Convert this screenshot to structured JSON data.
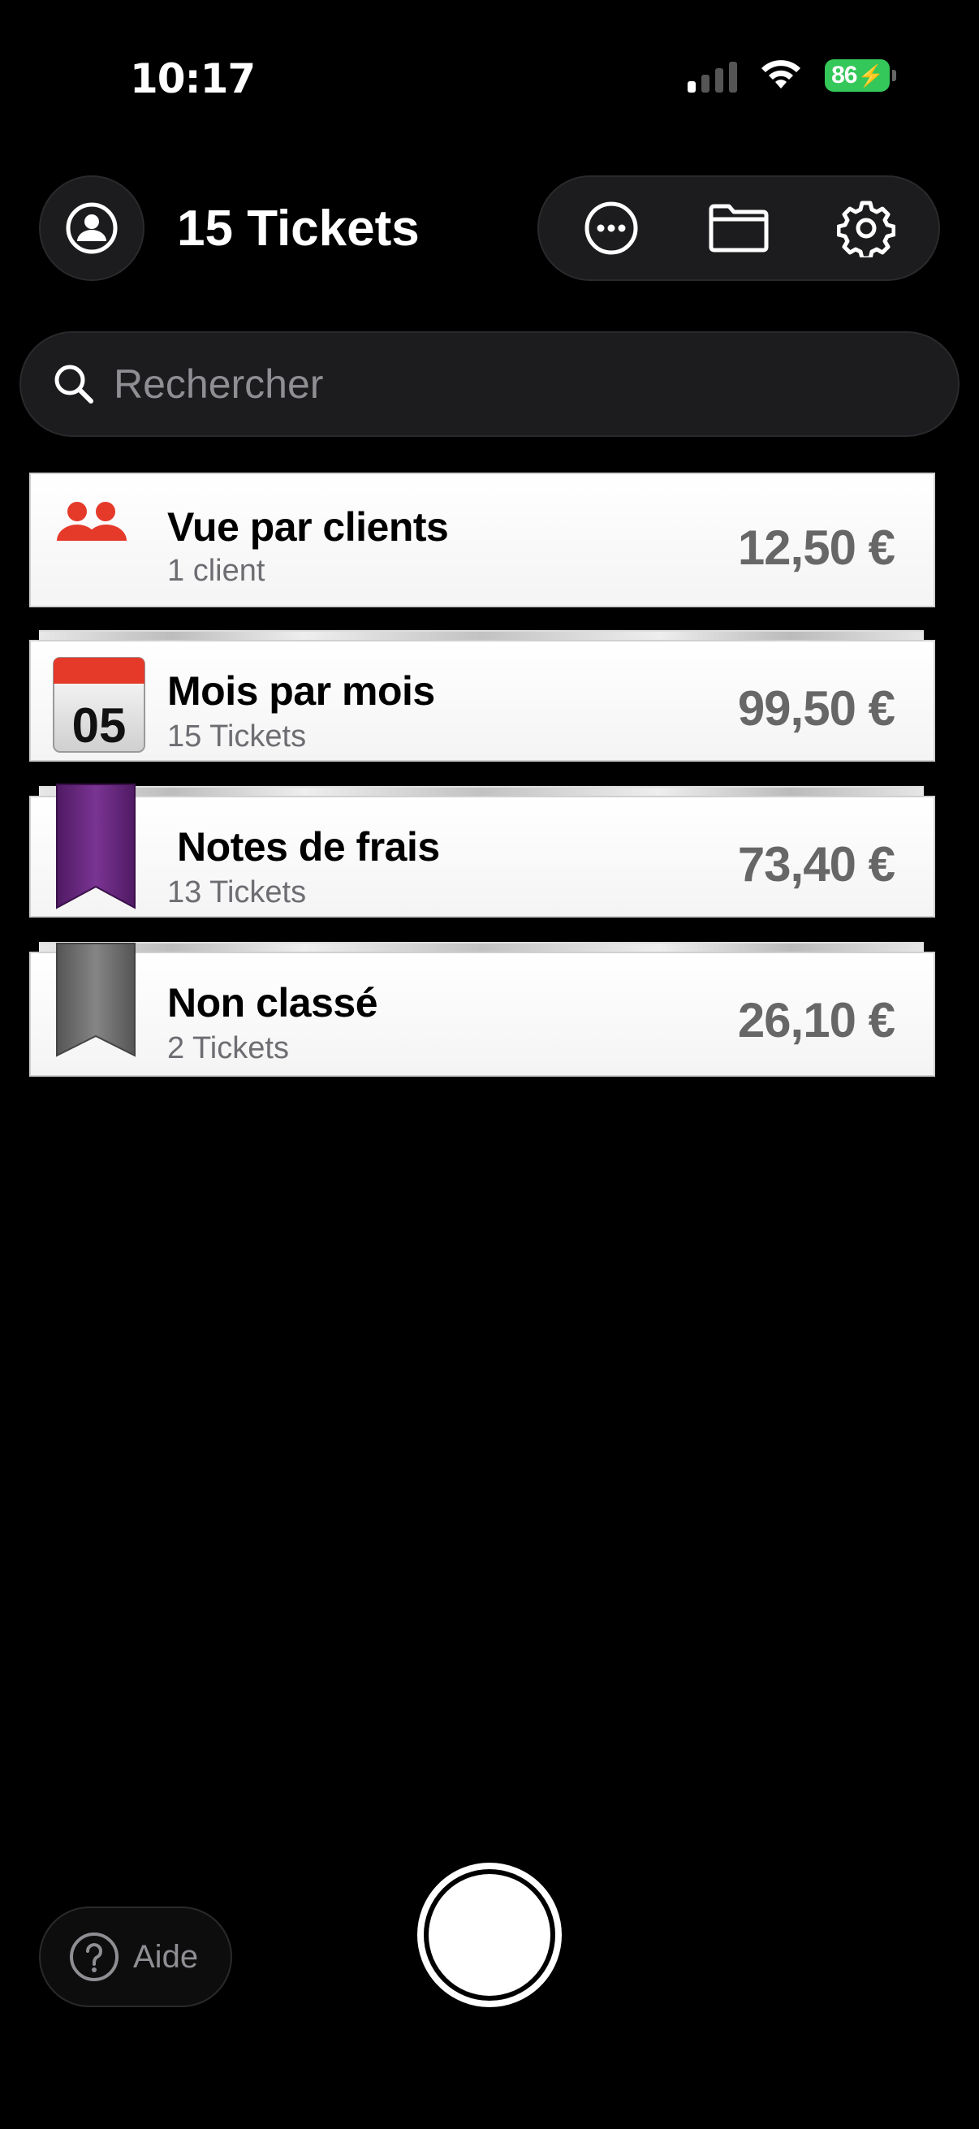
{
  "status_bar": {
    "time": "10:17",
    "battery": "86"
  },
  "header": {
    "title": "15 Tickets"
  },
  "icons": {
    "profile": "person-circle-icon",
    "more": "ellipsis-circle-icon",
    "folder": "folder-icon",
    "settings": "gear-icon",
    "search": "search-icon",
    "help": "question-circle-icon"
  },
  "search": {
    "placeholder": "Rechercher"
  },
  "cards": [
    {
      "title": "Vue par clients",
      "subtitle": "1 client",
      "amount": "12,50 €",
      "icon": "people-icon"
    },
    {
      "title": "Mois par mois",
      "subtitle": "15 Tickets",
      "amount": "99,50 €",
      "icon": "calendar-icon",
      "calendar_day": "05"
    },
    {
      "title": "Notes de frais",
      "subtitle": "13 Tickets",
      "amount": "73,40 €",
      "icon": "bookmark-purple-icon"
    },
    {
      "title": "Non classé",
      "subtitle": "2 Tickets",
      "amount": "26,10 €",
      "icon": "bookmark-gray-icon"
    }
  ],
  "footer": {
    "help_label": "Aide"
  },
  "colors": {
    "accent_red": "#e53a2a",
    "purple_ribbon": "#6e2a85",
    "gray_ribbon": "#6a6a6a",
    "battery_green": "#34c759"
  }
}
